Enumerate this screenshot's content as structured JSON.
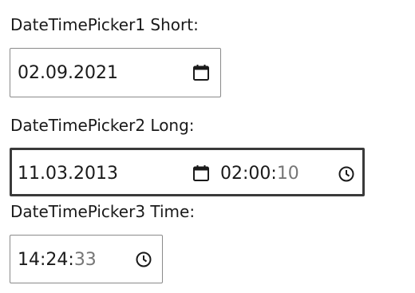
{
  "pickers": [
    {
      "label": "DateTimePicker1 Short:",
      "date": "02.09.2021",
      "date_icon": "calendar-icon"
    },
    {
      "label": "DateTimePicker2 Long:",
      "date": "11.03.2013",
      "date_icon": "calendar-icon",
      "time_hm": "02:00:",
      "time_seconds": "10",
      "time_icon": "clock-icon"
    },
    {
      "label": "DateTimePicker3 Time:",
      "time_hm": "14:24:",
      "time_seconds": "33",
      "time_icon": "clock-icon"
    }
  ],
  "colors": {
    "text": "#1a1a1a",
    "dim_text": "#767676",
    "border": "#8a8a8a",
    "focus_border": "#3a3a3a"
  }
}
